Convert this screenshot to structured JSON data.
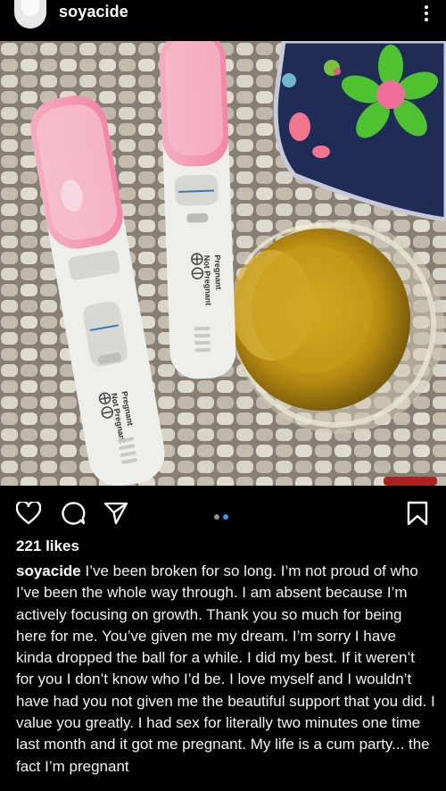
{
  "post": {
    "username": "soyacide",
    "likes": "221 likes",
    "caption": "I’ve been broken for so long. I’m not proud of who I’ve been the whole way through. I am absent because I’m actively focusing on growth. Thank you so much for being here for me. You’ve given me my dream. I’m sorry I have kinda dropped the ball for a while. I did my best. If it weren’t for you I don’t know who I’d be. I love myself and I wouldn’t have had you not given me the beautiful support that you did. I value you greatly.  I had sex for literally two minutes one time last month and it got me pregnant. My life is a cum party... the fact I’m pregnant",
    "carousel": {
      "count": 2,
      "active": 1
    }
  },
  "photo": {
    "test1_labels": [
      "Pregnant",
      "Not Pregnant"
    ],
    "test2_labels": [
      "Pregnant",
      "Not Pregnant"
    ]
  },
  "icons": {
    "avatar": "avatar",
    "more": "more-vertical-icon",
    "like": "heart-icon",
    "comment": "comment-icon",
    "share": "send-icon",
    "save": "bookmark-icon"
  },
  "colors": {
    "background": "#000000",
    "carousel_active": "#3897f0",
    "carousel_inactive": "#8e8e8e"
  }
}
